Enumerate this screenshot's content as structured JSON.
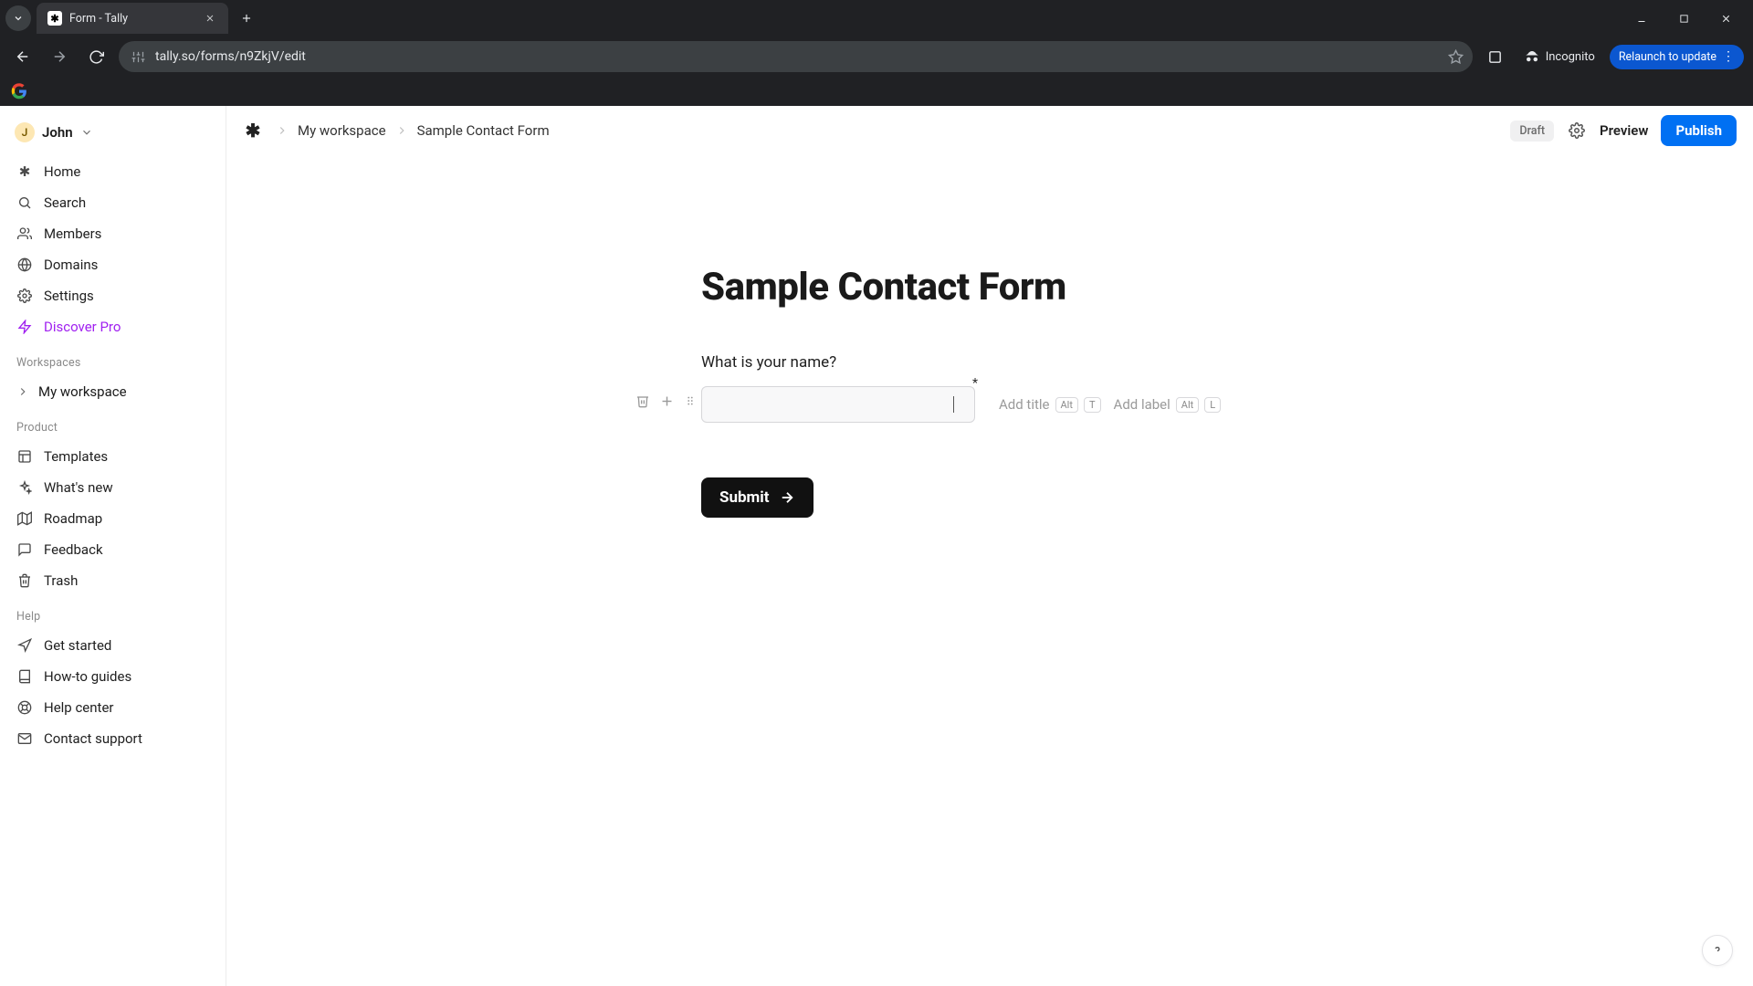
{
  "browser": {
    "tab_title": "Form - Tally",
    "url": "tally.so/forms/n9ZkjV/edit",
    "incognito_label": "Incognito",
    "relaunch_label": "Relaunch to update"
  },
  "user": {
    "initial": "J",
    "name": "John"
  },
  "sidebar": {
    "nav": [
      {
        "key": "home",
        "label": "Home"
      },
      {
        "key": "search",
        "label": "Search"
      },
      {
        "key": "members",
        "label": "Members"
      },
      {
        "key": "domains",
        "label": "Domains"
      },
      {
        "key": "settings",
        "label": "Settings"
      },
      {
        "key": "discover",
        "label": "Discover Pro"
      }
    ],
    "workspaces_label": "Workspaces",
    "workspaces": [
      {
        "label": "My workspace"
      }
    ],
    "product_label": "Product",
    "product": [
      {
        "key": "templates",
        "label": "Templates"
      },
      {
        "key": "whatsnew",
        "label": "What's new"
      },
      {
        "key": "roadmap",
        "label": "Roadmap"
      },
      {
        "key": "feedback",
        "label": "Feedback"
      },
      {
        "key": "trash",
        "label": "Trash"
      }
    ],
    "help_label": "Help",
    "help": [
      {
        "key": "getstarted",
        "label": "Get started"
      },
      {
        "key": "guides",
        "label": "How-to guides"
      },
      {
        "key": "helpcenter",
        "label": "Help center"
      },
      {
        "key": "contact",
        "label": "Contact support"
      }
    ]
  },
  "header": {
    "breadcrumbs": [
      {
        "label": "My workspace"
      },
      {
        "label": "Sample Contact Form"
      }
    ],
    "draft_label": "Draft",
    "preview_label": "Preview",
    "publish_label": "Publish"
  },
  "form": {
    "title": "Sample Contact Form",
    "question_label": "What is your name?",
    "input_value": "",
    "add_title_label": "Add title",
    "add_title_key1": "Alt",
    "add_title_key2": "T",
    "add_label_label": "Add label",
    "add_label_key1": "Alt",
    "add_label_key2": "L",
    "submit_label": "Submit"
  },
  "colors": {
    "accent_blue": "#0070f3",
    "discover_purple": "#a020f0",
    "chrome_blue": "#0b57d0"
  }
}
